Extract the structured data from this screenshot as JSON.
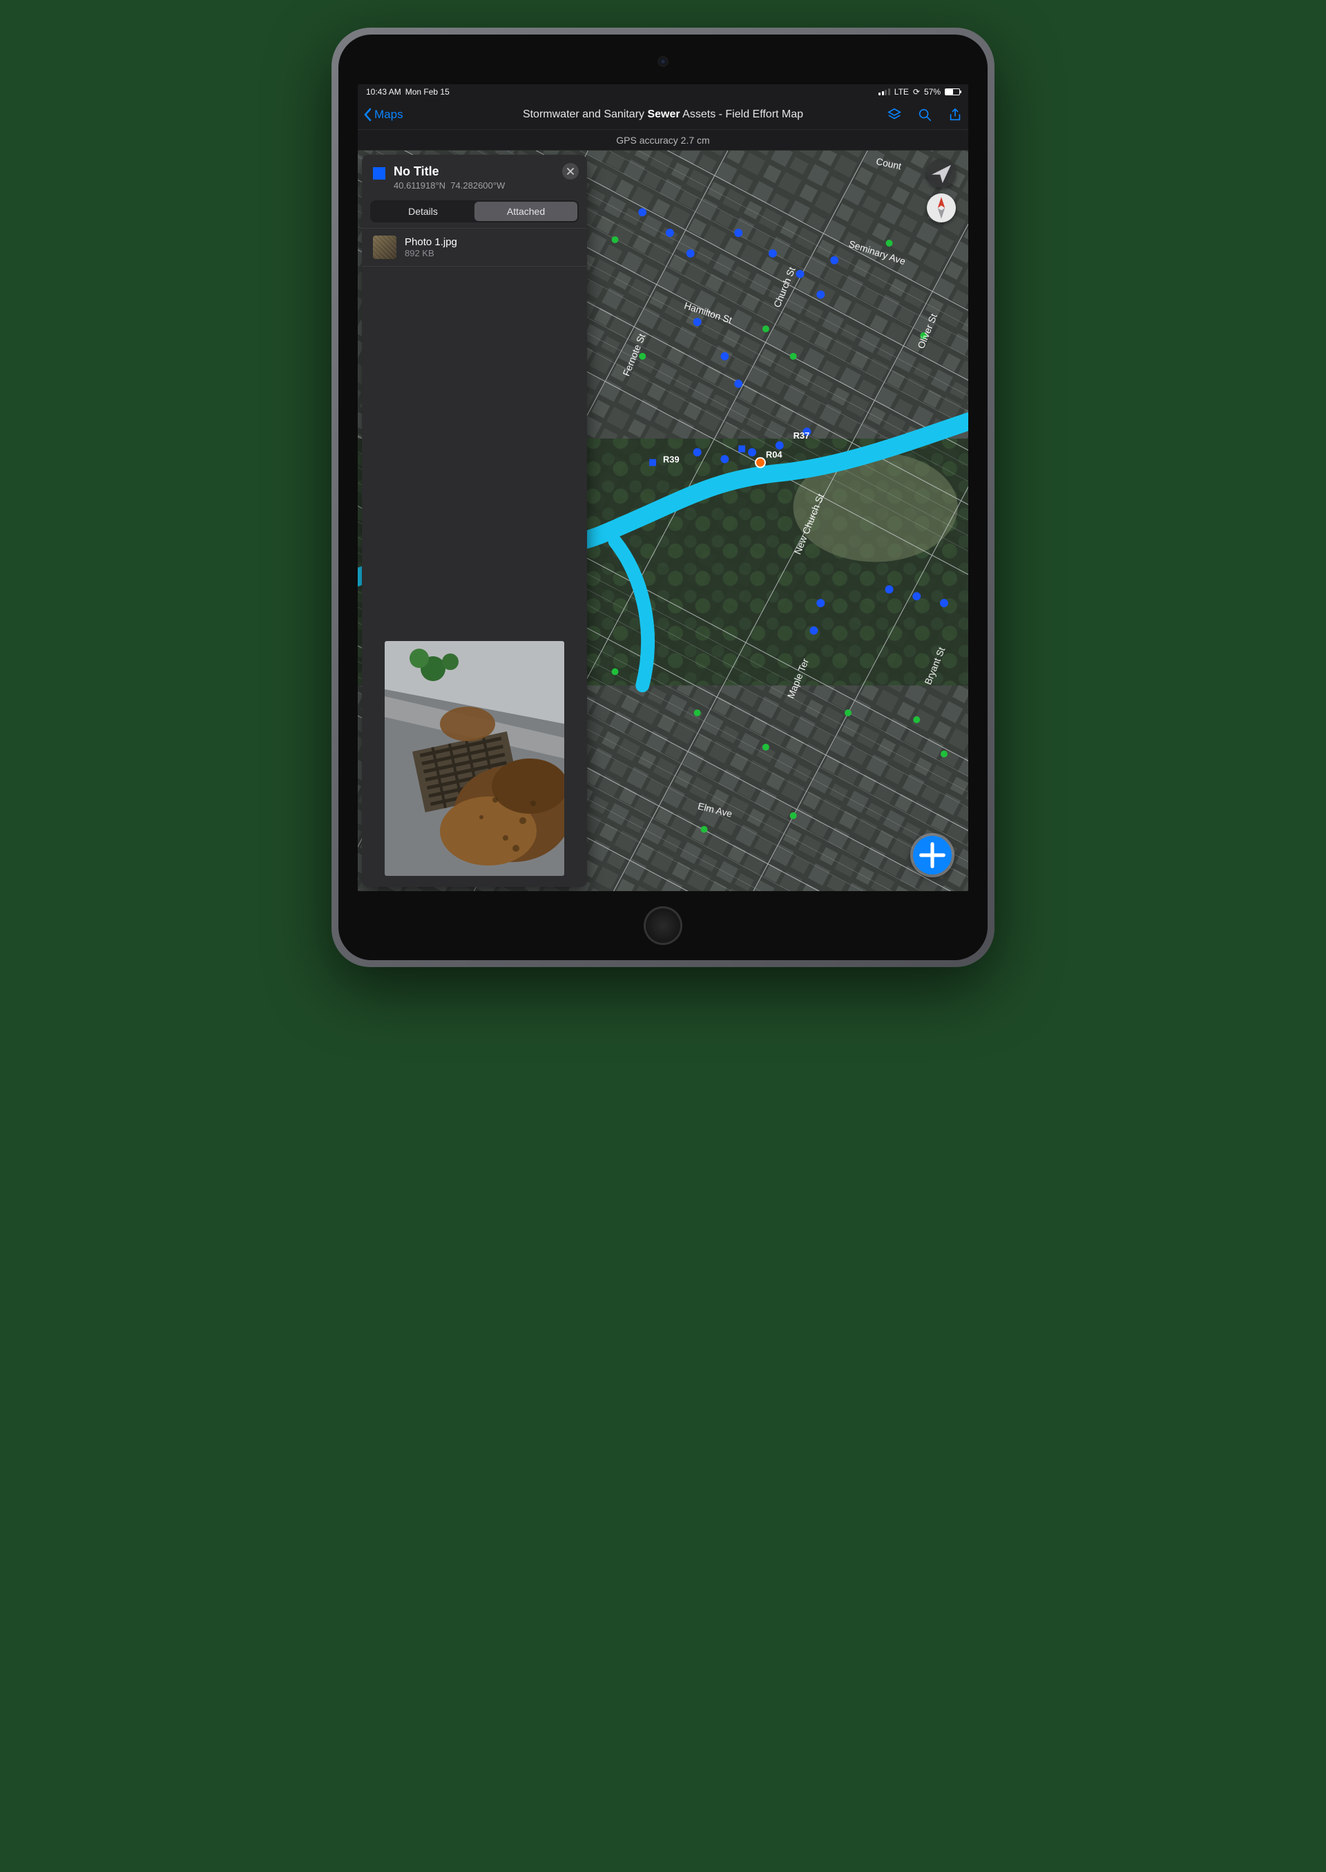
{
  "status_bar": {
    "time": "10:43 AM",
    "date": "Mon Feb 15",
    "carrier": "LTE",
    "battery_pct": "57%"
  },
  "nav": {
    "back_label": "Maps",
    "title_prefix": "Stormwater and Sanitary ",
    "title_highlight": "Sewer",
    "title_suffix": " Assets - Field Effort Map"
  },
  "gps": {
    "text": "GPS accuracy 2.7 cm"
  },
  "panel": {
    "title": "No Title",
    "lat": "40.611918°N",
    "lon": "74.282600°W",
    "tabs": {
      "details": "Details",
      "attached": "Attached",
      "active": "attached"
    },
    "attachment": {
      "name": "Photo 1.jpg",
      "size": "892 KB"
    }
  },
  "map": {
    "streets": [
      "Count",
      "Seminary Ave",
      "Hamilton St",
      "Church St",
      "Oliver St",
      "Fernote St",
      "New Church St",
      "Maple Ter",
      "Bryant St",
      "Elm Ave"
    ],
    "labels": {
      "r39": "R39",
      "r37": "R37",
      "r04": "R04"
    }
  }
}
